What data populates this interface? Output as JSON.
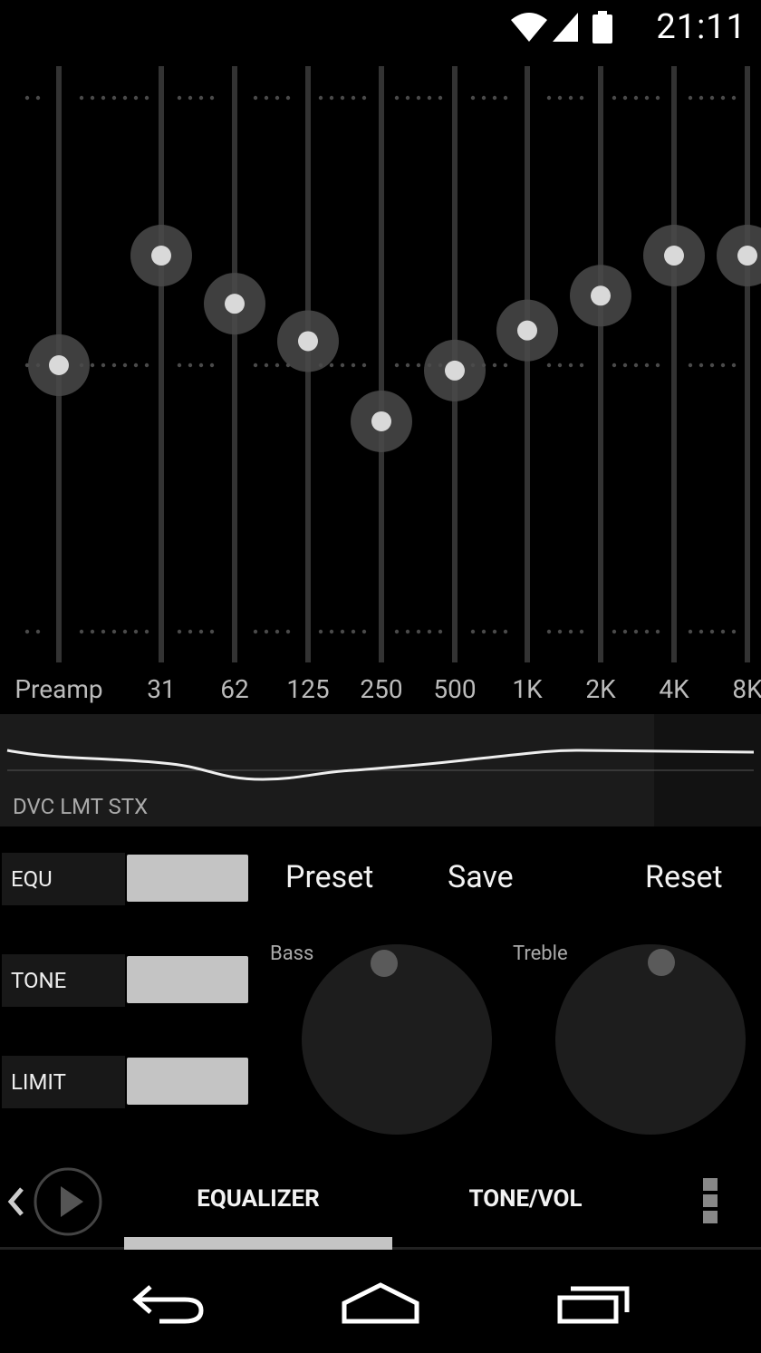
{
  "status_bar": {
    "time": "21:11"
  },
  "equalizer": {
    "bands": [
      {
        "label": "Preamp",
        "level": 0
      },
      {
        "label": "31",
        "level": 0.41
      },
      {
        "label": "62",
        "level": 0.23
      },
      {
        "label": "125",
        "level": 0.09
      },
      {
        "label": "250",
        "level": -0.21
      },
      {
        "label": "500",
        "level": -0.02
      },
      {
        "label": "1K",
        "level": 0.13
      },
      {
        "label": "2K",
        "level": 0.26
      },
      {
        "label": "4K",
        "level": 0.41
      },
      {
        "label": "8K",
        "level": 0.41
      }
    ]
  },
  "curve": {
    "status": "DVC LMT STX"
  },
  "toggles": [
    {
      "label": "EQU",
      "on": true
    },
    {
      "label": "TONE",
      "on": true
    },
    {
      "label": "LIMIT",
      "on": true
    }
  ],
  "actions": {
    "preset": "Preset",
    "save": "Save",
    "reset": "Reset"
  },
  "knobs": {
    "bass_label": "Bass",
    "treble_label": "Treble"
  },
  "tabs": {
    "equalizer": "EQUALIZER",
    "tone_vol": "TONE/VOL"
  },
  "colors": {
    "background": "#000000",
    "track": "#333333",
    "handle": "#d9d9d9",
    "switch": "#c4c4c4"
  }
}
